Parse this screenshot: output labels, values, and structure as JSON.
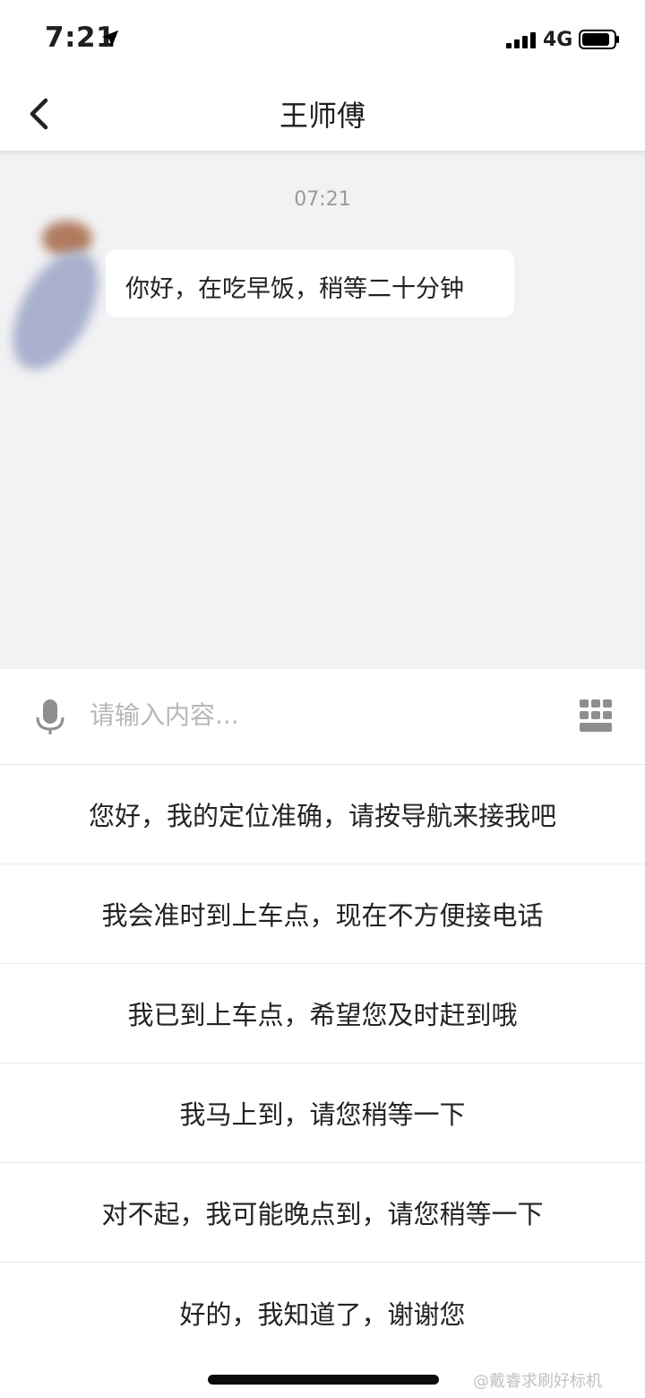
{
  "status_bar": {
    "time": "7:21",
    "network": "4G",
    "icons": [
      "location-arrow-icon",
      "signal-icon",
      "battery-icon"
    ]
  },
  "nav": {
    "title": "王师傅",
    "back_icon": "chevron-left-icon"
  },
  "chat": {
    "messages": [
      {
        "time": "07:21",
        "sender": "driver",
        "text": "你好，在吃早饭，稍等二十分钟"
      }
    ]
  },
  "input": {
    "placeholder": "请输入内容...",
    "left_icon": "microphone-icon",
    "right_icon": "keyboard-icon"
  },
  "quick_replies": [
    "您好，我的定位准确，请按导航来接我吧",
    "我会准时到上车点，现在不方便接电话",
    "我已到上车点，希望您及时赶到哦",
    "我马上到，请您稍等一下",
    "对不起，我可能晚点到，请您稍等一下",
    "好的，我知道了，谢谢您"
  ],
  "watermark": "@戴睿求刷好标机",
  "colors": {
    "chat_background": "#f2f2f4",
    "bubble": "#ffffff",
    "placeholder": "#b7b7b7",
    "icon_gray": "#8e8e8e"
  }
}
